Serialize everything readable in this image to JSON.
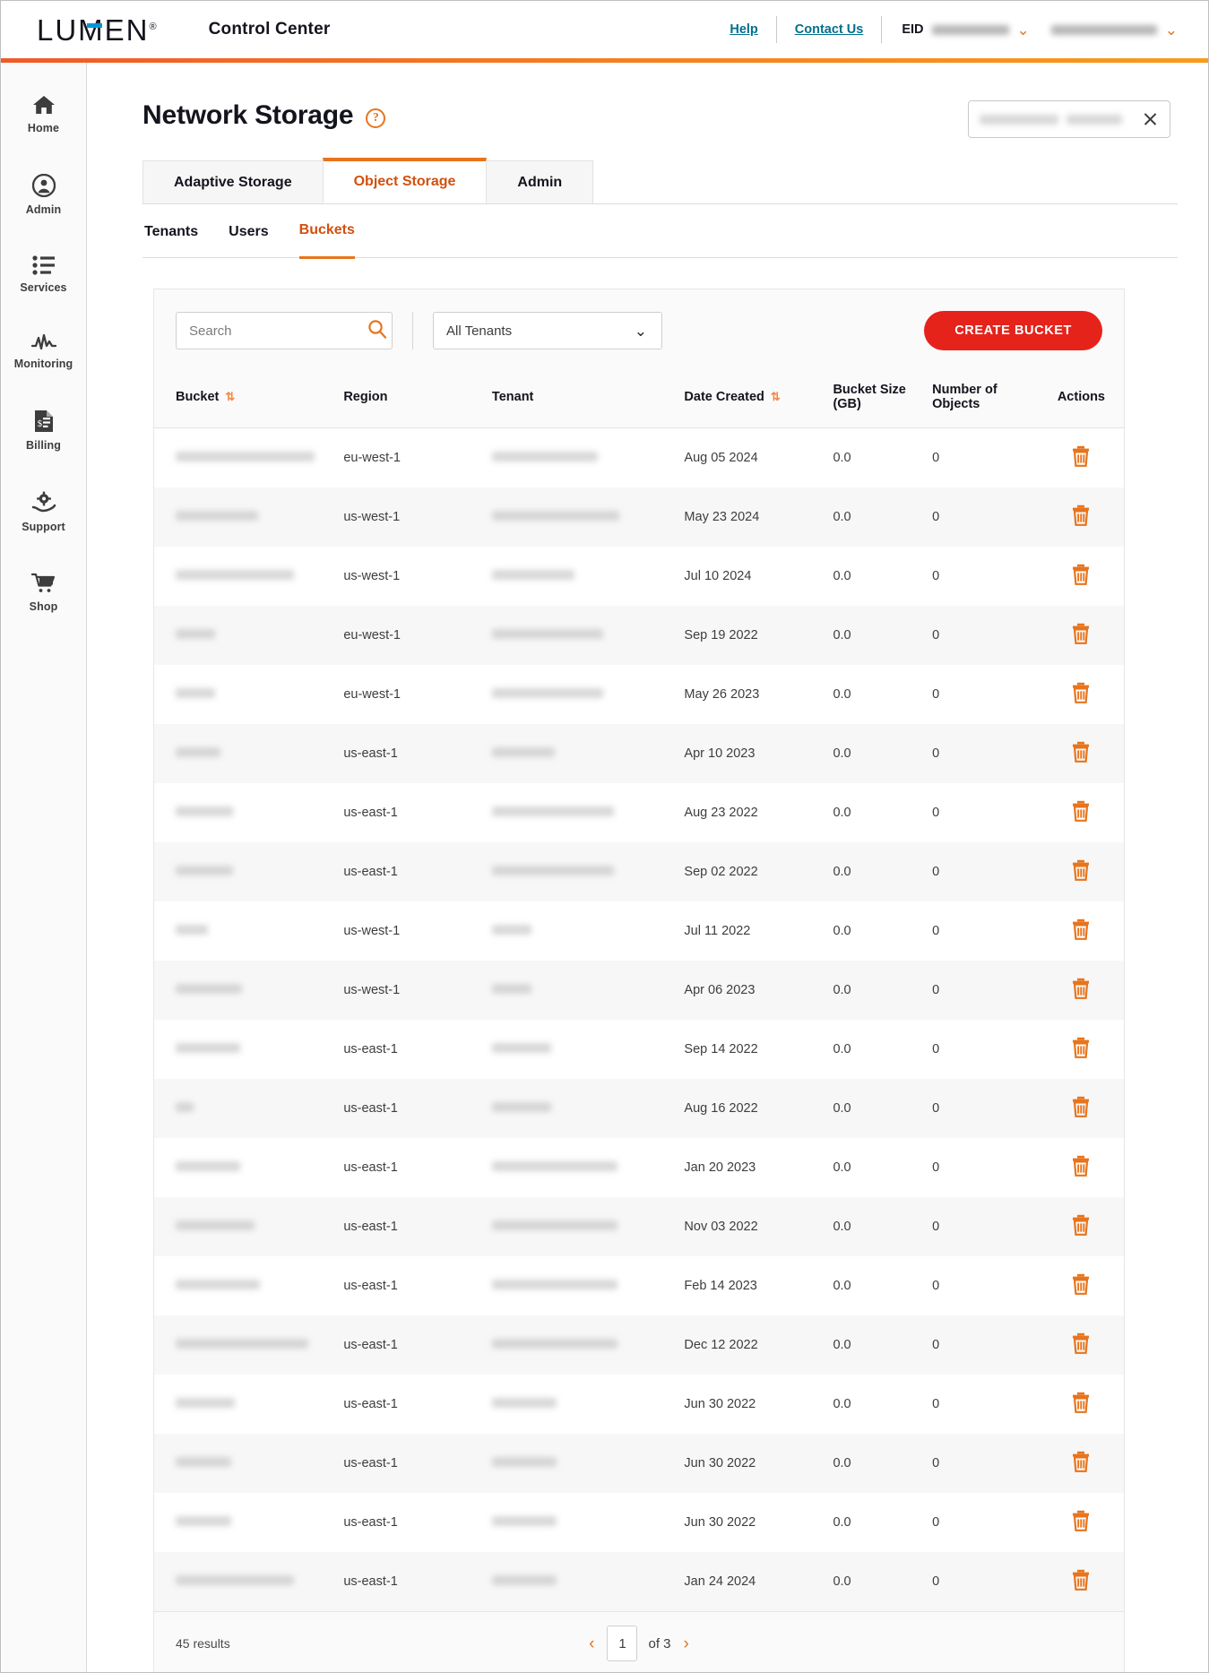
{
  "header": {
    "brand": "LUMEN",
    "brand_mark": "®",
    "app_title": "Control Center",
    "help_link": "Help",
    "contact_link": "Contact Us",
    "eid_label": "EID",
    "eid_value": "",
    "account_value": ""
  },
  "sidebar": {
    "items": [
      {
        "label": "Home",
        "icon": "home-icon"
      },
      {
        "label": "Admin",
        "icon": "user-circle-icon"
      },
      {
        "label": "Services",
        "icon": "list-icon"
      },
      {
        "label": "Monitoring",
        "icon": "pulse-icon"
      },
      {
        "label": "Billing",
        "icon": "invoice-icon"
      },
      {
        "label": "Support",
        "icon": "support-gear-hand-icon"
      },
      {
        "label": "Shop",
        "icon": "cart-icon"
      }
    ]
  },
  "page": {
    "title": "Network Storage",
    "help_icon_label": "?",
    "global_search_value": "",
    "global_search_placeholder": ""
  },
  "tabs": [
    {
      "label": "Adaptive Storage",
      "active": false
    },
    {
      "label": "Object Storage",
      "active": true
    },
    {
      "label": "Admin",
      "active": false
    }
  ],
  "subtabs": [
    {
      "label": "Tenants",
      "active": false
    },
    {
      "label": "Users",
      "active": false
    },
    {
      "label": "Buckets",
      "active": true
    }
  ],
  "toolbar": {
    "search_placeholder": "Search",
    "search_value": "",
    "tenant_filter_value": "All Tenants",
    "create_button": "CREATE BUCKET"
  },
  "table": {
    "columns": [
      {
        "key": "bucket",
        "label": "Bucket",
        "sortable": true
      },
      {
        "key": "region",
        "label": "Region",
        "sortable": false
      },
      {
        "key": "tenant",
        "label": "Tenant",
        "sortable": false
      },
      {
        "key": "date",
        "label": "Date Created",
        "sortable": true
      },
      {
        "key": "size",
        "label": "Bucket Size (GB)",
        "sortable": false
      },
      {
        "key": "objects",
        "label": "Number of Objects",
        "sortable": false
      },
      {
        "key": "actions",
        "label": "Actions",
        "sortable": false
      }
    ],
    "sort_glyph": "⇅",
    "rows": [
      {
        "bucket": "",
        "bucket_w": 155,
        "region": "eu-west-1",
        "tenant": "",
        "tenant_w": 118,
        "date": "Aug 05 2024",
        "size": "0.0",
        "objects": "0"
      },
      {
        "bucket": "",
        "bucket_w": 92,
        "region": "us-west-1",
        "tenant": "",
        "tenant_w": 142,
        "date": "May 23 2024",
        "size": "0.0",
        "objects": "0"
      },
      {
        "bucket": "",
        "bucket_w": 132,
        "region": "us-west-1",
        "tenant": "",
        "tenant_w": 92,
        "date": "Jul 10 2024",
        "size": "0.0",
        "objects": "0"
      },
      {
        "bucket": "",
        "bucket_w": 44,
        "region": "eu-west-1",
        "tenant": "",
        "tenant_w": 124,
        "date": "Sep 19 2022",
        "size": "0.0",
        "objects": "0"
      },
      {
        "bucket": "",
        "bucket_w": 44,
        "region": "eu-west-1",
        "tenant": "",
        "tenant_w": 124,
        "date": "May 26 2023",
        "size": "0.0",
        "objects": "0"
      },
      {
        "bucket": "",
        "bucket_w": 50,
        "region": "us-east-1",
        "tenant": "",
        "tenant_w": 70,
        "date": "Apr 10 2023",
        "size": "0.0",
        "objects": "0"
      },
      {
        "bucket": "",
        "bucket_w": 64,
        "region": "us-east-1",
        "tenant": "",
        "tenant_w": 136,
        "date": "Aug 23 2022",
        "size": "0.0",
        "objects": "0"
      },
      {
        "bucket": "",
        "bucket_w": 64,
        "region": "us-east-1",
        "tenant": "",
        "tenant_w": 136,
        "date": "Sep 02 2022",
        "size": "0.0",
        "objects": "0"
      },
      {
        "bucket": "",
        "bucket_w": 36,
        "region": "us-west-1",
        "tenant": "",
        "tenant_w": 44,
        "date": "Jul 11 2022",
        "size": "0.0",
        "objects": "0"
      },
      {
        "bucket": "",
        "bucket_w": 74,
        "region": "us-west-1",
        "tenant": "",
        "tenant_w": 44,
        "date": "Apr 06 2023",
        "size": "0.0",
        "objects": "0"
      },
      {
        "bucket": "",
        "bucket_w": 72,
        "region": "us-east-1",
        "tenant": "",
        "tenant_w": 66,
        "date": "Sep 14 2022",
        "size": "0.0",
        "objects": "0"
      },
      {
        "bucket": "",
        "bucket_w": 20,
        "region": "us-east-1",
        "tenant": "",
        "tenant_w": 66,
        "date": "Aug 16 2022",
        "size": "0.0",
        "objects": "0"
      },
      {
        "bucket": "",
        "bucket_w": 72,
        "region": "us-east-1",
        "tenant": "",
        "tenant_w": 140,
        "date": "Jan 20 2023",
        "size": "0.0",
        "objects": "0"
      },
      {
        "bucket": "",
        "bucket_w": 88,
        "region": "us-east-1",
        "tenant": "",
        "tenant_w": 140,
        "date": "Nov 03 2022",
        "size": "0.0",
        "objects": "0"
      },
      {
        "bucket": "",
        "bucket_w": 94,
        "region": "us-east-1",
        "tenant": "",
        "tenant_w": 140,
        "date": "Feb 14 2023",
        "size": "0.0",
        "objects": "0"
      },
      {
        "bucket": "",
        "bucket_w": 148,
        "region": "us-east-1",
        "tenant": "",
        "tenant_w": 140,
        "date": "Dec 12 2022",
        "size": "0.0",
        "objects": "0"
      },
      {
        "bucket": "",
        "bucket_w": 66,
        "region": "us-east-1",
        "tenant": "",
        "tenant_w": 72,
        "date": "Jun 30 2022",
        "size": "0.0",
        "objects": "0"
      },
      {
        "bucket": "",
        "bucket_w": 62,
        "region": "us-east-1",
        "tenant": "",
        "tenant_w": 72,
        "date": "Jun 30 2022",
        "size": "0.0",
        "objects": "0"
      },
      {
        "bucket": "",
        "bucket_w": 62,
        "region": "us-east-1",
        "tenant": "",
        "tenant_w": 72,
        "date": "Jun 30 2022",
        "size": "0.0",
        "objects": "0"
      },
      {
        "bucket": "",
        "bucket_w": 132,
        "region": "us-east-1",
        "tenant": "",
        "tenant_w": 72,
        "date": "Jan 24 2024",
        "size": "0.0",
        "objects": "0"
      }
    ]
  },
  "footer": {
    "results_text": "45 results",
    "page_value": "1",
    "of_text": "of 3",
    "prev_glyph": "‹",
    "next_glyph": "›"
  },
  "colors": {
    "brand_orange": "#e8741c",
    "brand_red": "#e5231b",
    "link_teal": "#00708c",
    "accent_blue": "#0098db"
  }
}
